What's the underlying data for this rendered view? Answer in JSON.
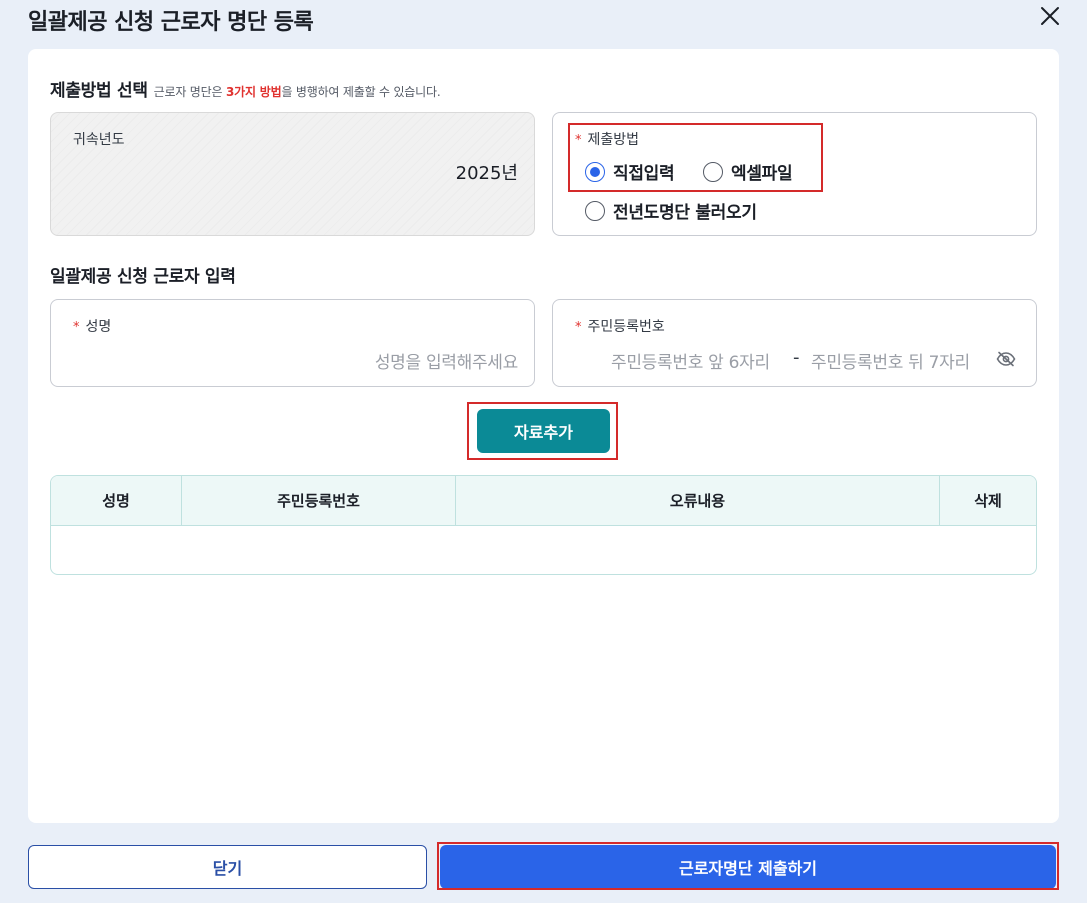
{
  "dialog": {
    "title": "일괄제공 신청 근로자 명단 등록"
  },
  "method_section": {
    "title": "제출방법 선택",
    "desc_prefix": "근로자 명단은 ",
    "desc_highlight": "3가지 방법",
    "desc_suffix": "을 병행하여 제출할 수 있습니다."
  },
  "year_field": {
    "label": "귀속년도",
    "value": "2025년"
  },
  "method_field": {
    "label": "제출방법",
    "options": [
      {
        "label": "직접입력",
        "checked": true
      },
      {
        "label": "엑셀파일",
        "checked": false
      },
      {
        "label": "전년도명단 불러오기",
        "checked": false
      }
    ]
  },
  "input_section": {
    "title": "일괄제공 신청 근로자 입력"
  },
  "name_field": {
    "label": "성명",
    "placeholder": "성명을 입력해주세요"
  },
  "rrn_field": {
    "label": "주민등록번호",
    "front_placeholder": "주민등록번호 앞 6자리",
    "separator": "-",
    "back_placeholder": "주민등록번호 뒤 7자리"
  },
  "add_button": {
    "label": "자료추가"
  },
  "table": {
    "columns": [
      "성명",
      "주민등록번호",
      "오류내용",
      "삭제"
    ],
    "rows": []
  },
  "footer": {
    "close_label": "닫기",
    "submit_label": "근로자명단 제출하기"
  },
  "colors": {
    "primary": "#2a64e8",
    "teal": "#0b8a96",
    "required": "#e0322f",
    "highlight_frame": "#d42a2a"
  }
}
